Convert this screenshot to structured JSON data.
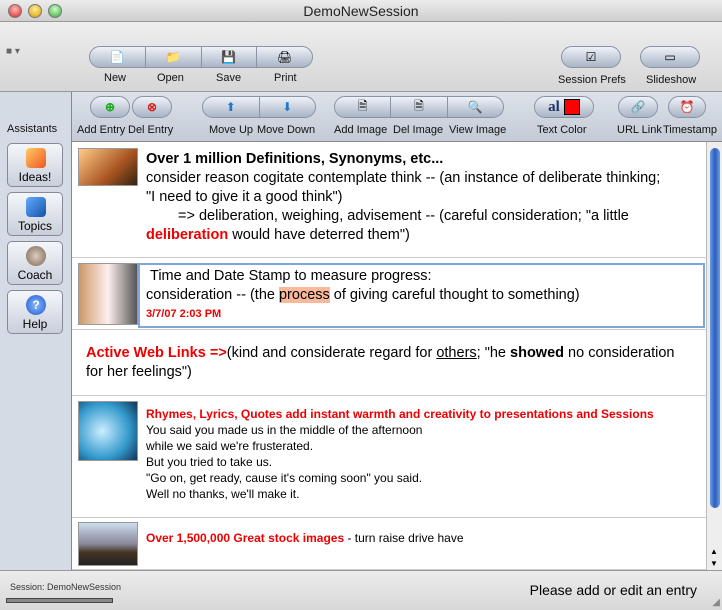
{
  "window": {
    "title": "DemoNewSession"
  },
  "toolbar": {
    "new": "New",
    "open": "Open",
    "save": "Save",
    "print": "Print",
    "session_prefs": "Session Prefs",
    "slideshow": "Slideshow"
  },
  "toolbar2": {
    "add_entry": "Add Entry",
    "del_entry": "Del Entry",
    "move_up": "Move Up",
    "move_down": "Move Down",
    "add_image": "Add Image",
    "del_image": "Del Image",
    "view_image": "View Image",
    "text_color": "Text Color",
    "url_link": "URL Link",
    "timestamp": "Timestamp",
    "text_color_glyph": "al",
    "text_color_value": "#ff0000"
  },
  "sidebar": {
    "title": "Assistants",
    "items": [
      {
        "label": "Ideas!"
      },
      {
        "label": "Topics"
      },
      {
        "label": "Coach"
      },
      {
        "label": "Help"
      }
    ]
  },
  "entries": [
    {
      "heading": "Over 1 million Definitions, Synonyms, etc...",
      "l1": "consider reason cogitate contemplate think -- (an instance of deliberate thinking;",
      "l2": "\"I need to give it a good think\")",
      "l3": "=> deliberation, weighing, advisement -- (careful consideration; \"a little",
      "l4a": "deliberation",
      "l4b": " would have deterred them\")"
    },
    {
      "heading": "Time and Date Stamp to measure progress:",
      "l1a": "consideration -- (the ",
      "l1b": "process",
      "l1c": " of giving careful thought to something)",
      "stamp": "3/7/07 2:03 PM"
    },
    {
      "l1a": "Active Web Links =>",
      "l1b": "(kind and considerate regard for ",
      "l1c": "others",
      "l1d": "; \"he ",
      "l1e": "showed",
      "l1f": " no consideration",
      "l2": "for her feelings\")"
    },
    {
      "heading": "Rhymes, Lyrics, Quotes add instant warmth and creativity to presentations and Sessions",
      "lines": [
        "You said you made us in the middle of the afternoon",
        "while we said we're frusterated.",
        "But you tried to take us.",
        "\"Go on, get ready, cause it's coming soon\" you said.",
        "Well no thanks, we'll make it."
      ]
    },
    {
      "heading": "Over 1,500,000 Great stock images",
      "rest": " - turn raise drive have"
    }
  ],
  "status": {
    "session": "Session: DemoNewSession",
    "message": "Please add or edit an entry"
  }
}
